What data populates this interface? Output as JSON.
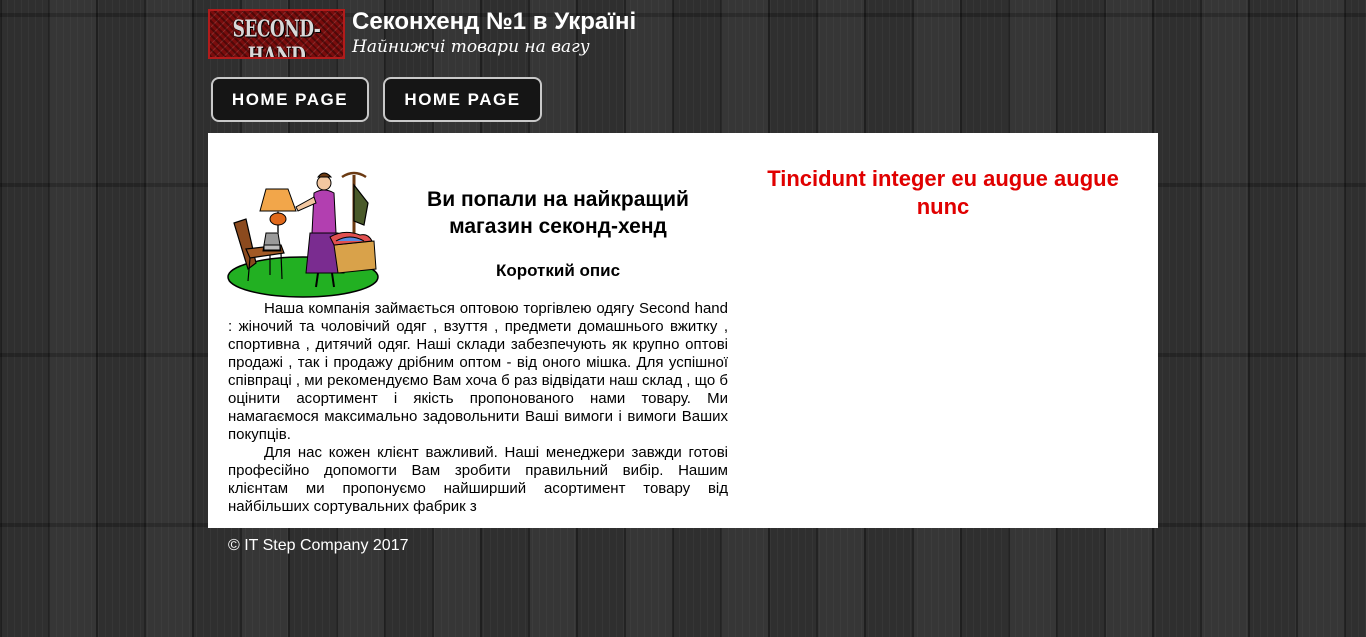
{
  "header": {
    "logo_text": "SECOND-HAND",
    "title": "Секонхенд №1 в Україні",
    "subtitle": "Найнижчі товари на вагу"
  },
  "nav": {
    "items": [
      {
        "label": "HOME PAGE"
      },
      {
        "label": "HOME PAGE"
      }
    ]
  },
  "main": {
    "heading": "Ви попали на найкращий магазин секонд-хенд",
    "subheading": "Короткий опис",
    "paragraphs": [
      "Наша компанія займається оптовою торгівлею одягу Second hand : жіночий та чоловічий одяг , взуття , предмети домашнього вжитку , спортивна , дитячий одяг. Наші склади забезпечують як крупно оптові продажі , так і продажу дрібним оптом - від оного мішка. Для успішної співпраці , ми рекомендуємо Вам хоча б раз відвідати наш склад , що б оцінити асортимент і якість пропонованого нами товару. Ми намагаємося максимально задовольнити Ваші вимоги і вимоги Ваших покупців.",
      "Для нас кожен клієнт важливий. Наші менеджери завжди готові професійно допомогти Вам зробити правильний вибір. Нашим клієнтам ми пропонуємо найширший асортимент товару від найбільших сортувальних фабрик з"
    ]
  },
  "sidebar": {
    "heading": "Tincidunt integer eu augue augue nunc"
  },
  "footer": {
    "copyright": "© IT Step Company 2017"
  },
  "colors": {
    "accent_red": "#e00000",
    "content_bg": "#ffffff",
    "page_bg": "#2b2b2b"
  }
}
